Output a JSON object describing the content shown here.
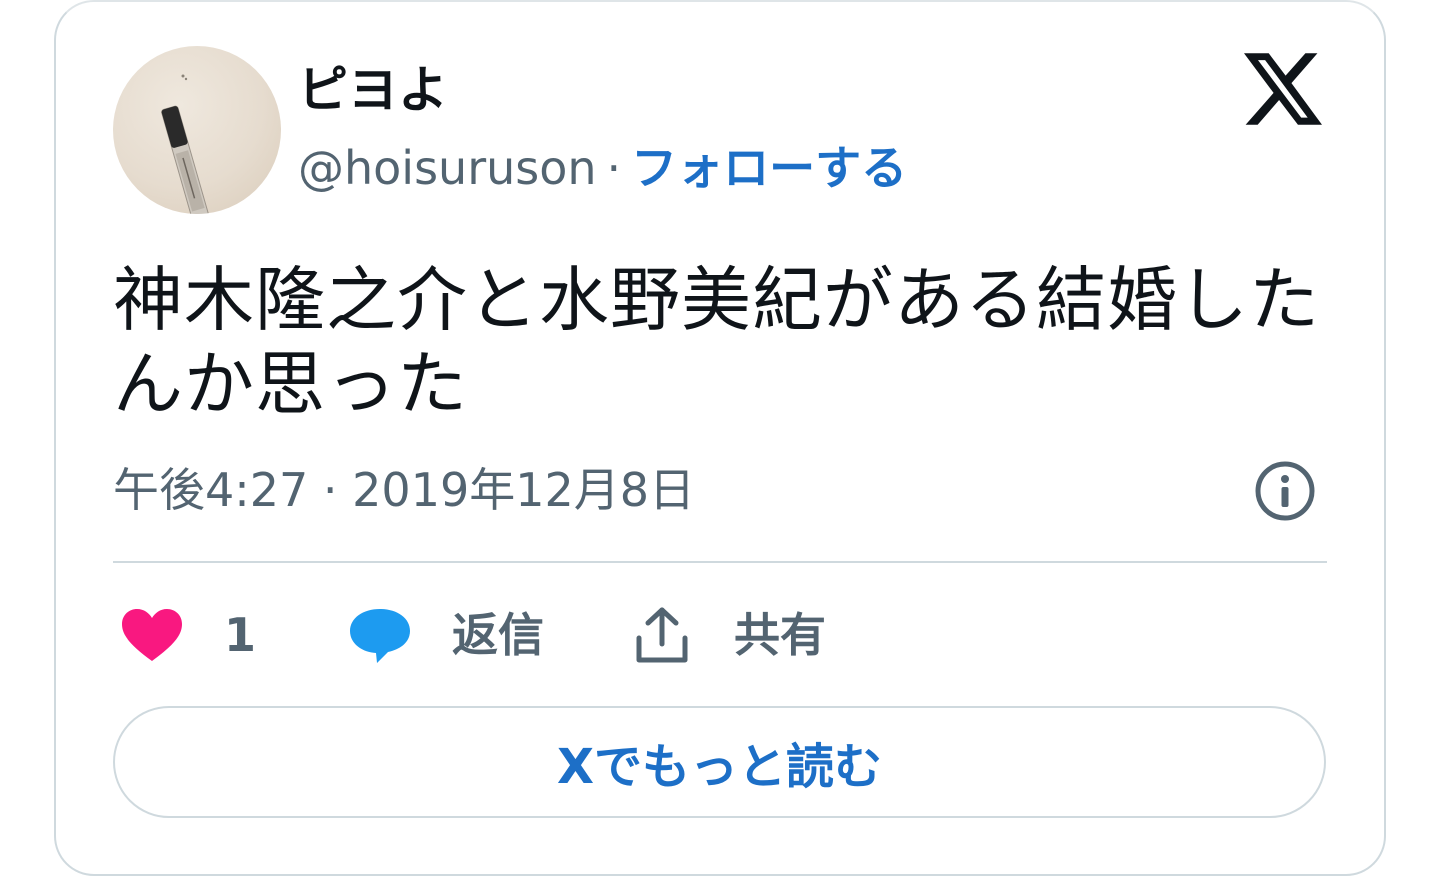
{
  "user": {
    "display_name": "ピヨよ",
    "handle": "@hoisuruson",
    "separator": "·",
    "follow_label": "フォローする"
  },
  "tweet": {
    "text": "神木隆之介と水野美紀がある結婚したんか思った",
    "timestamp": "午後4:27 · 2019年12月8日"
  },
  "actions": {
    "like_count": "1",
    "reply_label": "返信",
    "share_label": "共有"
  },
  "read_more_label": "Xでもっと読む",
  "colors": {
    "accent": "#1d6fc7",
    "like": "#f91880",
    "reply_bubble": "#1d9bf0",
    "text": "#0f1419",
    "muted": "#536471",
    "border": "#cfd9de"
  },
  "icons": {
    "brand": "x-logo-icon",
    "info": "info-icon",
    "like": "heart-icon",
    "reply": "speech-bubble-icon",
    "share": "share-upload-icon"
  }
}
